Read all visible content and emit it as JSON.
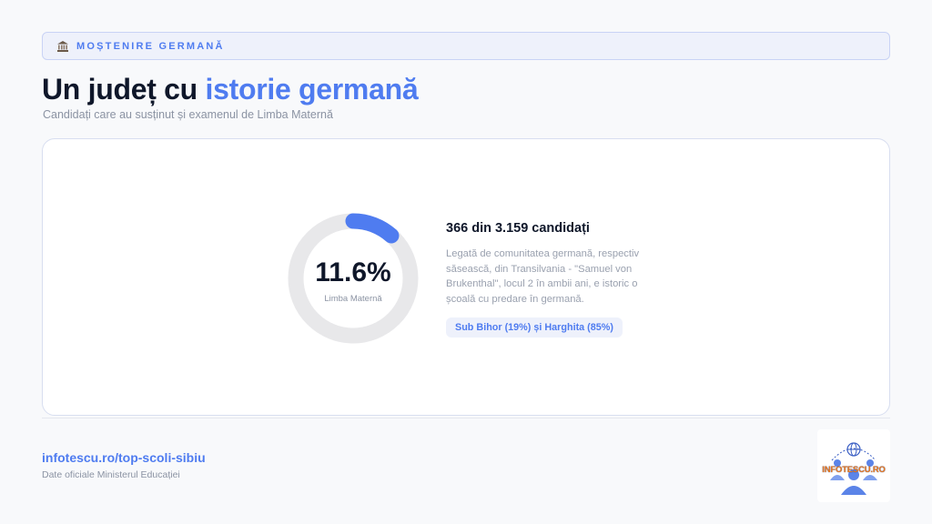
{
  "header": {
    "pill_icon": "bank-building-icon",
    "pill_label": "MOȘTENIRE GERMANĂ",
    "title_plain": "Un județ cu ",
    "title_accent": "istorie germană",
    "subtitle": "Candidați care au susținut și examenul de Limba Maternă"
  },
  "stat": {
    "percent_value": 11.6,
    "percent_label": "11.6%",
    "caption": "Limba Maternă",
    "headline": "366 din 3.159 candidați",
    "description": "Legată de comunitatea germană, respectiv săsească, din Transilvania - \"Samuel von Brukenthal\", locul 2 în ambii ani, e istoric o școală cu predare în germană.",
    "badge": "Sub Bihor (19%) și Harghita (85%)"
  },
  "footer": {
    "link": "infotescu.ro/top-scoli-sibiu",
    "note": "Date oficiale Ministerul Educației",
    "logo_text": "INFOTESCU.RO",
    "logo_icon": "globe-people-logo-icon"
  },
  "colors": {
    "accent": "#4f7cf0",
    "ring_track": "#e8e8ea",
    "logo_orange": "#e8791e"
  }
}
